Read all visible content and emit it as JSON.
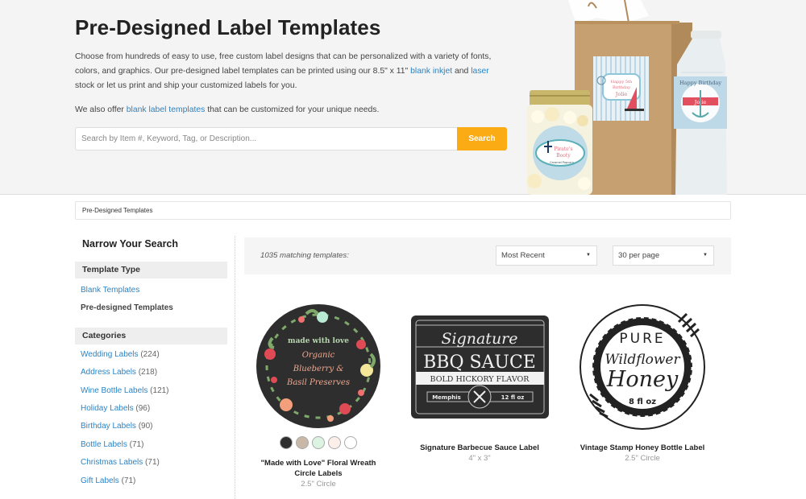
{
  "hero": {
    "title": "Pre-Designed Label Templates",
    "desc_part1": "Choose from hundreds of easy to use, free custom label designs that can be personalized with a variety of fonts, colors, and graphics. Our pre-designed label templates can be printed using our 8.5\" x 11\" ",
    "desc_link1": "blank inkjet",
    "desc_part2": " and ",
    "desc_link2": "laser",
    "desc_part3": " stock or let us print and ship your customized labels for you.",
    "desc2_part1": "We also offer ",
    "desc2_link": "blank label templates",
    "desc2_part2": " that can be customized for your unique needs.",
    "search_placeholder": "Search by Item #, Keyword, Tag, or Description...",
    "search_value": "",
    "search_button": "Search",
    "image_labels": {
      "bag_label": "Happy 5th Birthday Jolie",
      "jar_label_title": "Pirate's Booty",
      "jar_label_sub": "Caramel Popcorn",
      "bottle_label_top": "Happy Birthday",
      "bottle_label_name": "Jolie"
    }
  },
  "breadcrumb": "Pre-Designed Templates",
  "sidebar": {
    "title": "Narrow Your Search",
    "template_type": {
      "heading": "Template Type",
      "items": [
        {
          "label": "Blank Templates",
          "active": false
        },
        {
          "label": "Pre-designed Templates",
          "active": true
        }
      ]
    },
    "categories": {
      "heading": "Categories",
      "items": [
        {
          "label": "Wedding Labels",
          "count": "(224)"
        },
        {
          "label": "Address Labels",
          "count": "(218)"
        },
        {
          "label": "Wine Bottle Labels",
          "count": "(121)"
        },
        {
          "label": "Holiday Labels",
          "count": "(96)"
        },
        {
          "label": "Birthday Labels",
          "count": "(90)"
        },
        {
          "label": "Bottle Labels",
          "count": "(71)"
        },
        {
          "label": "Christmas Labels",
          "count": "(71)"
        },
        {
          "label": "Gift Labels",
          "count": "(71)"
        }
      ]
    }
  },
  "results": {
    "count_text": "1035 matching templates:",
    "sort_selected": "Most Recent",
    "per_page_selected": "30 per page"
  },
  "products": [
    {
      "title": "\"Made with Love\" Floral Wreath Circle Labels",
      "size": "2.5\" Circle",
      "label_text": {
        "line1": "made with love",
        "line2": "Organic",
        "line3": "Blueberry &",
        "line4": "Basil Preserves"
      },
      "swatches": [
        "#2e2e2e",
        "#c9b8a8",
        "#dcf3e2",
        "#fcefe9",
        "#ffffff"
      ]
    },
    {
      "title": "Signature Barbecue Sauce Label",
      "size": "4\" x 3\"",
      "label_text": {
        "line1": "Signature",
        "line2": "BBQ SAUCE",
        "line3": "BOLD HICKORY FLAVOR",
        "left": "Memphis",
        "right": "12 fl oz"
      }
    },
    {
      "title": "Vintage Stamp Honey Bottle Label",
      "size": "2.5\" Circle",
      "label_text": {
        "line1": "PURE",
        "line2": "Wildflower",
        "line3": "Honey",
        "line4": "8 fl oz"
      }
    }
  ],
  "colors": {
    "accent": "#fbab14",
    "link": "#2a84c4"
  }
}
